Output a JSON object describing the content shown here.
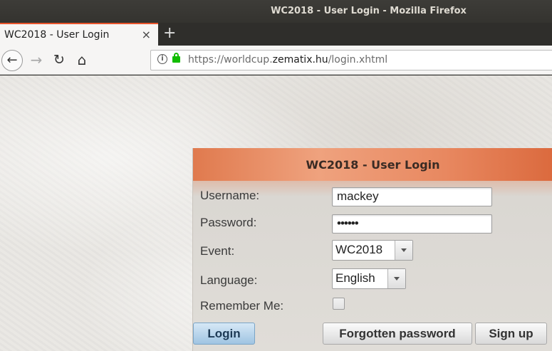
{
  "window": {
    "title": "WC2018 - User Login - Mozilla Firefox"
  },
  "tab": {
    "title": "WC2018 - User Login",
    "close": "×"
  },
  "newtab": "+",
  "nav": {
    "back": "←",
    "forward": "→",
    "reload": "↻",
    "home": "⌂",
    "info": "i"
  },
  "url": {
    "prefix": "https://worldcup.",
    "domain": "zematix.hu",
    "path": "/login.xhtml"
  },
  "login": {
    "title": "WC2018 - User Login",
    "username_label": "Username:",
    "username_value": "mackey",
    "password_label": "Password:",
    "password_value": "••••••",
    "event_label": "Event:",
    "event_value": "WC2018",
    "language_label": "Language:",
    "language_value": "English",
    "remember_label": "Remember Me:",
    "login_button": "Login",
    "forgot_button": "Forgotten password",
    "signup_button": "Sign up"
  },
  "colors": {
    "header_accent": "#e07a4e",
    "tab_accent": "#e9542c",
    "lock": "#12bc00",
    "login_button": "#9fc4e2"
  }
}
